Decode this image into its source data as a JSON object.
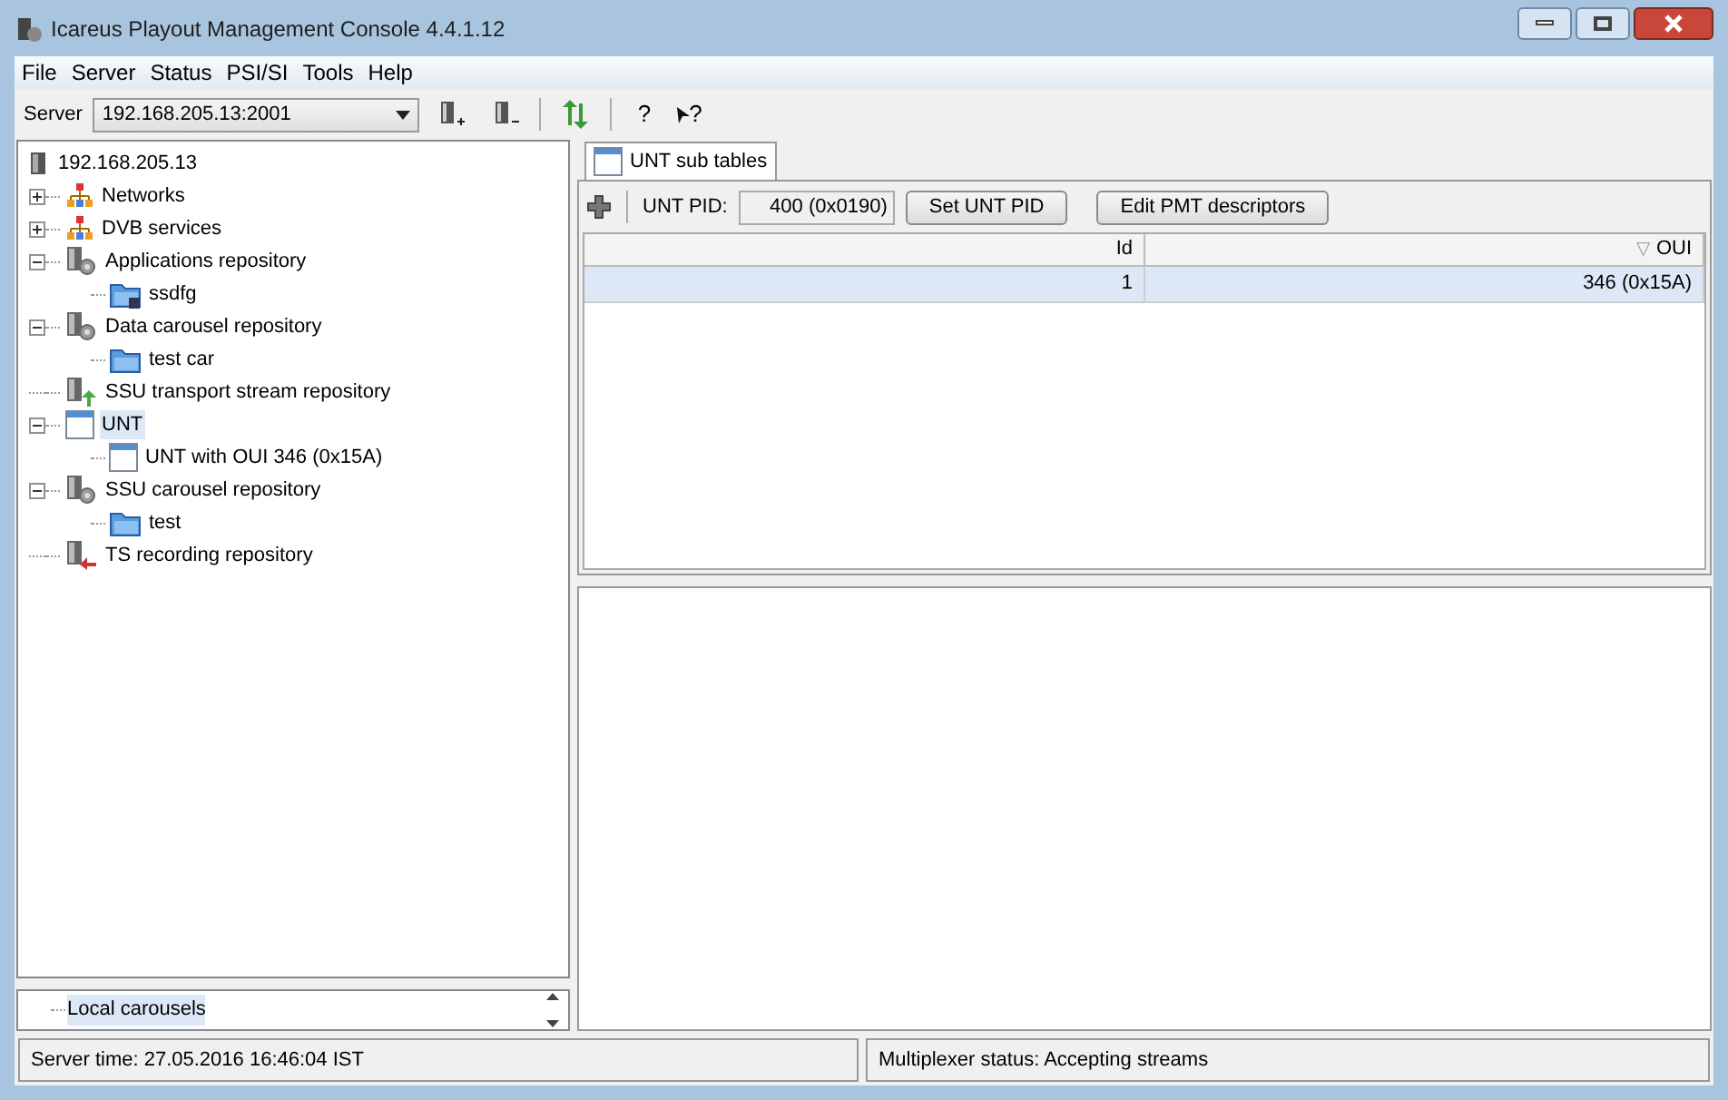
{
  "window": {
    "title": "Icareus Playout Management Console 4.4.1.12"
  },
  "menu": [
    "File",
    "Server",
    "Status",
    "PSI/SI",
    "Tools",
    "Help"
  ],
  "toolbar": {
    "server_label": "Server",
    "server_value": "192.168.205.13:2001",
    "help": "?",
    "context_help": "?"
  },
  "tree": {
    "label": "192.168.205.13",
    "kind": "server",
    "children": [
      {
        "label": "Networks",
        "kind": "network",
        "expanded": false,
        "selected": false
      },
      {
        "label": "DVB services",
        "kind": "network",
        "expanded": false,
        "selected": false
      },
      {
        "label": "Applications repository",
        "kind": "repo",
        "expanded": true,
        "selected": false,
        "children": [
          {
            "label": "ssdfg",
            "kind": "app-folder",
            "selected": false
          }
        ]
      },
      {
        "label": "Data carousel repository",
        "kind": "repo",
        "expanded": true,
        "selected": false,
        "children": [
          {
            "label": "test car",
            "kind": "folder",
            "selected": false
          }
        ]
      },
      {
        "label": "SSU transport stream repository",
        "kind": "ssu",
        "selected": false
      },
      {
        "label": "UNT",
        "kind": "table",
        "expanded": true,
        "selected": true,
        "children": [
          {
            "label": "UNT with OUI 346 (0x15A)",
            "kind": "table",
            "selected": false
          }
        ]
      },
      {
        "label": "SSU carousel repository",
        "kind": "repo",
        "expanded": true,
        "selected": false,
        "children": [
          {
            "label": "test",
            "kind": "folder",
            "selected": false
          }
        ]
      },
      {
        "label": "TS recording repository",
        "kind": "ts",
        "selected": false
      }
    ]
  },
  "local_list": [
    {
      "label": "Local carousels",
      "selected": true
    }
  ],
  "tabs": [
    {
      "label": "UNT sub tables",
      "selected": true
    }
  ],
  "unt_panel": {
    "pid_label": "UNT PID:",
    "pid_value": "400 (0x0190)",
    "buttons": [
      "Set UNT PID",
      "Edit PMT descriptors"
    ]
  },
  "table": {
    "columns": [
      {
        "label": "Id"
      },
      {
        "label": "OUI",
        "sort_glyph": "▽"
      }
    ],
    "rows": [
      {
        "cells": [
          "1",
          "346 (0x15A)"
        ],
        "selected": true
      }
    ]
  },
  "status_bar": [
    "Server time: 27.05.2016 16:46:04 IST",
    "Multiplexer status: Accepting streams"
  ]
}
